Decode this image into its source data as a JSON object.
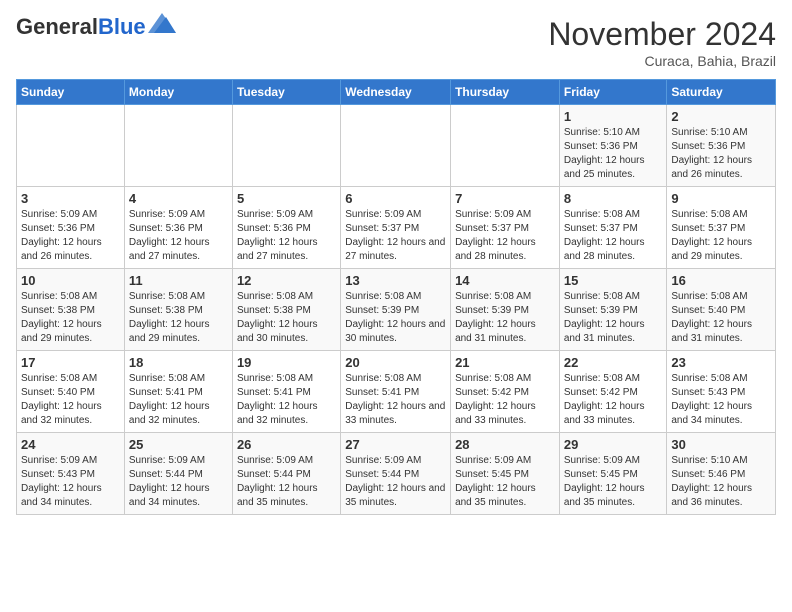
{
  "header": {
    "logo_general": "General",
    "logo_blue": "Blue",
    "month_title": "November 2024",
    "location": "Curaca, Bahia, Brazil"
  },
  "weekdays": [
    "Sunday",
    "Monday",
    "Tuesday",
    "Wednesday",
    "Thursday",
    "Friday",
    "Saturday"
  ],
  "weeks": [
    [
      {
        "day": "",
        "info": ""
      },
      {
        "day": "",
        "info": ""
      },
      {
        "day": "",
        "info": ""
      },
      {
        "day": "",
        "info": ""
      },
      {
        "day": "",
        "info": ""
      },
      {
        "day": "1",
        "info": "Sunrise: 5:10 AM\nSunset: 5:36 PM\nDaylight: 12 hours and 25 minutes."
      },
      {
        "day": "2",
        "info": "Sunrise: 5:10 AM\nSunset: 5:36 PM\nDaylight: 12 hours and 26 minutes."
      }
    ],
    [
      {
        "day": "3",
        "info": "Sunrise: 5:09 AM\nSunset: 5:36 PM\nDaylight: 12 hours and 26 minutes."
      },
      {
        "day": "4",
        "info": "Sunrise: 5:09 AM\nSunset: 5:36 PM\nDaylight: 12 hours and 27 minutes."
      },
      {
        "day": "5",
        "info": "Sunrise: 5:09 AM\nSunset: 5:36 PM\nDaylight: 12 hours and 27 minutes."
      },
      {
        "day": "6",
        "info": "Sunrise: 5:09 AM\nSunset: 5:37 PM\nDaylight: 12 hours and 27 minutes."
      },
      {
        "day": "7",
        "info": "Sunrise: 5:09 AM\nSunset: 5:37 PM\nDaylight: 12 hours and 28 minutes."
      },
      {
        "day": "8",
        "info": "Sunrise: 5:08 AM\nSunset: 5:37 PM\nDaylight: 12 hours and 28 minutes."
      },
      {
        "day": "9",
        "info": "Sunrise: 5:08 AM\nSunset: 5:37 PM\nDaylight: 12 hours and 29 minutes."
      }
    ],
    [
      {
        "day": "10",
        "info": "Sunrise: 5:08 AM\nSunset: 5:38 PM\nDaylight: 12 hours and 29 minutes."
      },
      {
        "day": "11",
        "info": "Sunrise: 5:08 AM\nSunset: 5:38 PM\nDaylight: 12 hours and 29 minutes."
      },
      {
        "day": "12",
        "info": "Sunrise: 5:08 AM\nSunset: 5:38 PM\nDaylight: 12 hours and 30 minutes."
      },
      {
        "day": "13",
        "info": "Sunrise: 5:08 AM\nSunset: 5:39 PM\nDaylight: 12 hours and 30 minutes."
      },
      {
        "day": "14",
        "info": "Sunrise: 5:08 AM\nSunset: 5:39 PM\nDaylight: 12 hours and 31 minutes."
      },
      {
        "day": "15",
        "info": "Sunrise: 5:08 AM\nSunset: 5:39 PM\nDaylight: 12 hours and 31 minutes."
      },
      {
        "day": "16",
        "info": "Sunrise: 5:08 AM\nSunset: 5:40 PM\nDaylight: 12 hours and 31 minutes."
      }
    ],
    [
      {
        "day": "17",
        "info": "Sunrise: 5:08 AM\nSunset: 5:40 PM\nDaylight: 12 hours and 32 minutes."
      },
      {
        "day": "18",
        "info": "Sunrise: 5:08 AM\nSunset: 5:41 PM\nDaylight: 12 hours and 32 minutes."
      },
      {
        "day": "19",
        "info": "Sunrise: 5:08 AM\nSunset: 5:41 PM\nDaylight: 12 hours and 32 minutes."
      },
      {
        "day": "20",
        "info": "Sunrise: 5:08 AM\nSunset: 5:41 PM\nDaylight: 12 hours and 33 minutes."
      },
      {
        "day": "21",
        "info": "Sunrise: 5:08 AM\nSunset: 5:42 PM\nDaylight: 12 hours and 33 minutes."
      },
      {
        "day": "22",
        "info": "Sunrise: 5:08 AM\nSunset: 5:42 PM\nDaylight: 12 hours and 33 minutes."
      },
      {
        "day": "23",
        "info": "Sunrise: 5:08 AM\nSunset: 5:43 PM\nDaylight: 12 hours and 34 minutes."
      }
    ],
    [
      {
        "day": "24",
        "info": "Sunrise: 5:09 AM\nSunset: 5:43 PM\nDaylight: 12 hours and 34 minutes."
      },
      {
        "day": "25",
        "info": "Sunrise: 5:09 AM\nSunset: 5:44 PM\nDaylight: 12 hours and 34 minutes."
      },
      {
        "day": "26",
        "info": "Sunrise: 5:09 AM\nSunset: 5:44 PM\nDaylight: 12 hours and 35 minutes."
      },
      {
        "day": "27",
        "info": "Sunrise: 5:09 AM\nSunset: 5:44 PM\nDaylight: 12 hours and 35 minutes."
      },
      {
        "day": "28",
        "info": "Sunrise: 5:09 AM\nSunset: 5:45 PM\nDaylight: 12 hours and 35 minutes."
      },
      {
        "day": "29",
        "info": "Sunrise: 5:09 AM\nSunset: 5:45 PM\nDaylight: 12 hours and 35 minutes."
      },
      {
        "day": "30",
        "info": "Sunrise: 5:10 AM\nSunset: 5:46 PM\nDaylight: 12 hours and 36 minutes."
      }
    ]
  ]
}
